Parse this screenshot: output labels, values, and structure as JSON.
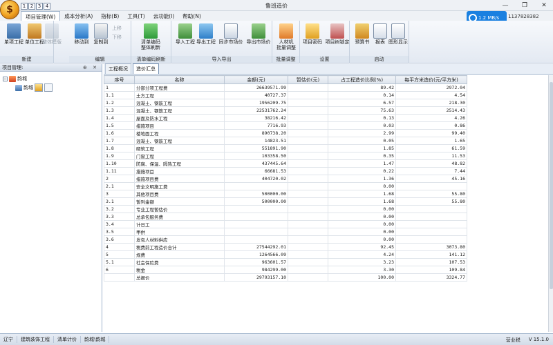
{
  "window": {
    "title": "鲁班造价",
    "qat_labels": [
      "1",
      "2",
      "3",
      "4"
    ],
    "controls": [
      "—",
      "❐",
      "✕"
    ]
  },
  "menu": {
    "tabs": [
      {
        "label": "项目管理(W)",
        "hint": "W",
        "active": true
      },
      {
        "label": "成本分析(A)",
        "hint": "A",
        "active": false
      },
      {
        "label": "指标(B)",
        "hint": "B",
        "active": false
      },
      {
        "label": "工具(T)",
        "hint": "T",
        "active": false
      },
      {
        "label": "云功能(I)",
        "hint": "I",
        "active": false
      },
      {
        "label": "帮助(N)",
        "hint": "N",
        "active": false
      }
    ]
  },
  "topright": {
    "speed": "1.2 MB/s",
    "phone": "1137828382"
  },
  "ribbon": {
    "groups": {
      "new": "新建",
      "edit": "编辑",
      "code_refresh": "清单编码刷新",
      "import_export": "导入导出",
      "batch": "批量调整",
      "settings": "设置",
      "launch": "启动"
    },
    "buttons": {
      "project": "单项工程",
      "unit": "单位工程",
      "whole": "整体模版",
      "move": "移动到",
      "copy": "复制到",
      "up": "上移",
      "down": "下移",
      "refresh_line1": "清单编码",
      "refresh_line2": "整体刷新",
      "import": "导入工程",
      "export": "导出工程",
      "sync_market": "同步市场价",
      "export_market": "导出市场价",
      "batch_line1": "人材机",
      "batch_line2": "批量调整",
      "password": "项目密码",
      "lock": "项目树锁定",
      "budget": "预算书",
      "report": "报表",
      "chart": "图形显示"
    },
    "hints": {
      "edit": "B",
      "refresh": "T",
      "import": "I",
      "export": "H",
      "unit": "U"
    }
  },
  "left_panel": {
    "title": "项目管理:",
    "controls": "⊕ ✕",
    "root": "韵城",
    "child": "韵城"
  },
  "doc_tabs": [
    {
      "label": "工程概况",
      "active": false
    },
    {
      "label": "造价汇总",
      "active": true
    }
  ],
  "table": {
    "columns": [
      "序号",
      "名称",
      "金额(元)",
      "暂估价(元)",
      "占工程造价比例(%)",
      "每平方米造价(元/平方米)"
    ],
    "rows": [
      [
        "1",
        "分部分项工程费",
        "26639571.99",
        "",
        "89.42",
        "2972.04"
      ],
      [
        "1.1",
        "土方工程",
        "40727.37",
        "",
        "0.14",
        "4.54"
      ],
      [
        "1.2",
        "混凝土、钢筋工程",
        "1956209.75",
        "",
        "6.57",
        "218.30"
      ],
      [
        "1.3",
        "混凝土、钢筋工程",
        "22531762.24",
        "",
        "75.63",
        "2514.43"
      ],
      [
        "1.4",
        "屋面及防水工程",
        "38216.42",
        "",
        "0.13",
        "4.26"
      ],
      [
        "1.5",
        "措施项目",
        "7716.93",
        "",
        "0.03",
        "0.86"
      ],
      [
        "1.6",
        "楼地面工程",
        "890738.20",
        "",
        "2.99",
        "99.40"
      ],
      [
        "1.7",
        "混凝土、钢筋工程",
        "14823.51",
        "",
        "0.05",
        "1.65"
      ],
      [
        "1.8",
        "砌筑工程",
        "551891.90",
        "",
        "1.85",
        "61.59"
      ],
      [
        "1.9",
        "门窗工程",
        "103358.50",
        "",
        "0.35",
        "11.53"
      ],
      [
        "1.10",
        "防腐、保温、隔热工程",
        "437445.64",
        "",
        "1.47",
        "48.82"
      ],
      [
        "1.11",
        "措施项目",
        "66681.53",
        "",
        "0.22",
        "7.44"
      ],
      [
        "2",
        "措施项目费",
        "404720.02",
        "",
        "1.36",
        "45.16"
      ],
      [
        "2.1",
        "安全文明施工费",
        "",
        "",
        "0.00",
        ""
      ],
      [
        "3",
        "其他项目费",
        "500000.00",
        "",
        "1.68",
        "55.80"
      ],
      [
        "3.1",
        "暂列金额",
        "500000.00",
        "",
        "1.68",
        "55.80"
      ],
      [
        "3.2",
        "专业工程暂估价",
        "",
        "",
        "0.00",
        ""
      ],
      [
        "3.3",
        "总承包服务费",
        "",
        "",
        "0.00",
        ""
      ],
      [
        "3.4",
        "计日工",
        "",
        "",
        "0.00",
        ""
      ],
      [
        "3.5",
        "甲供",
        "",
        "",
        "0.00",
        ""
      ],
      [
        "3.6",
        "发包人材料供应",
        "",
        "",
        "0.00",
        ""
      ],
      [
        "4",
        "税费前工程造价合计",
        "27544292.01",
        "",
        "92.45",
        "3073.80"
      ],
      [
        "5",
        "规费",
        "1264566.09",
        "",
        "4.24",
        "141.12"
      ],
      [
        "5.1",
        "社会保险费",
        "963601.57",
        "",
        "3.23",
        "107.53"
      ],
      [
        "6",
        "税金",
        "984299.00",
        "",
        "3.30",
        "109.84"
      ],
      [
        "",
        "总报价",
        "29793157.10",
        "",
        "100.00",
        "3324.77"
      ]
    ]
  },
  "statusbar": {
    "items": [
      "辽宁",
      "建筑装饰工程",
      "清单计价",
      "韵城\\韵城"
    ],
    "right": [
      "营业税",
      "V 15.1.0"
    ]
  }
}
